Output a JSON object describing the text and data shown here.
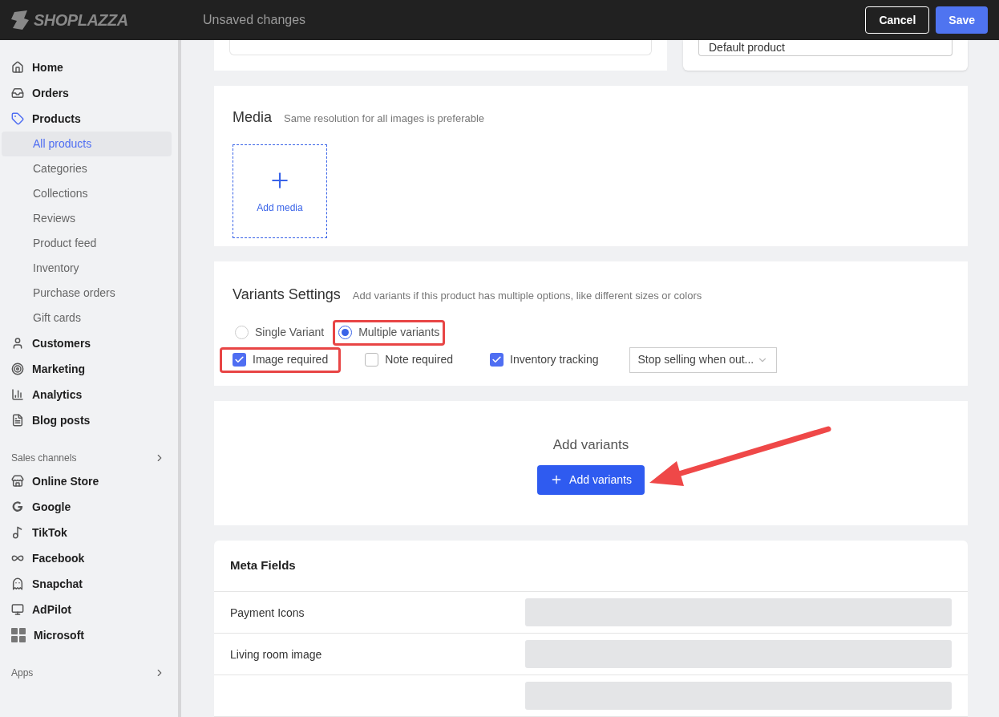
{
  "topbar": {
    "logo": "SHOPLAZZA",
    "title": "Unsaved changes",
    "buttons": [
      {
        "label": "Cancel",
        "kind": "secondary"
      },
      {
        "label": "Save",
        "kind": "primary"
      }
    ]
  },
  "sidebar": {
    "items": [
      {
        "kind": "item",
        "label": "Home"
      },
      {
        "kind": "item",
        "label": "Orders"
      },
      {
        "kind": "item",
        "label": "Products",
        "children": [
          {
            "label": "All products",
            "selected": true
          },
          {
            "label": "Categories",
            "selected": false
          },
          {
            "label": "Collections",
            "selected": false
          },
          {
            "label": "Reviews",
            "selected": false
          },
          {
            "label": "Product feed",
            "selected": false
          },
          {
            "label": "Inventory",
            "selected": false
          },
          {
            "label": "Purchase orders",
            "selected": false
          },
          {
            "label": "Gift cards",
            "selected": false
          }
        ]
      },
      {
        "kind": "item",
        "label": "Customers"
      },
      {
        "kind": "item",
        "label": "Marketing"
      },
      {
        "kind": "item",
        "label": "Analytics"
      },
      {
        "kind": "item",
        "label": "Blog posts"
      },
      {
        "kind": "section",
        "label": "Sales channels"
      },
      {
        "kind": "item",
        "label": "Online Store"
      },
      {
        "kind": "item",
        "label": "Google"
      },
      {
        "kind": "item",
        "label": "TikTok"
      },
      {
        "kind": "item",
        "label": "Facebook"
      },
      {
        "kind": "item",
        "label": "Snapchat"
      },
      {
        "kind": "item",
        "label": "AdPilot"
      },
      {
        "kind": "item",
        "label": "Microsoft"
      },
      {
        "kind": "section",
        "label": "Apps"
      }
    ]
  },
  "product_type": {
    "value": "Default product"
  },
  "media": {
    "title": "Media",
    "hint": "Same resolution for all images is preferable",
    "add_label": "Add media"
  },
  "variants_settings": {
    "title": "Variants Settings",
    "hint": "Add variants if this product has multiple options, like different sizes or colors",
    "radios": [
      {
        "label": "Single Variant",
        "selected": false,
        "highlighted": false
      },
      {
        "label": "Multiple variants",
        "selected": true,
        "highlighted": true
      }
    ],
    "checkboxes": [
      {
        "label": "Image required",
        "checked": true,
        "highlighted": true
      },
      {
        "label": "Note required",
        "checked": false,
        "highlighted": false
      },
      {
        "label": "Inventory tracking",
        "checked": true,
        "highlighted": false
      }
    ],
    "stock_select": {
      "value": "Stop selling when out..."
    }
  },
  "add_variants": {
    "title": "Add variants",
    "button": "Add variants"
  },
  "meta_fields": {
    "title": "Meta Fields",
    "rows": [
      {
        "label": "Payment Icons"
      },
      {
        "label": "Living room image"
      },
      {}
    ]
  }
}
